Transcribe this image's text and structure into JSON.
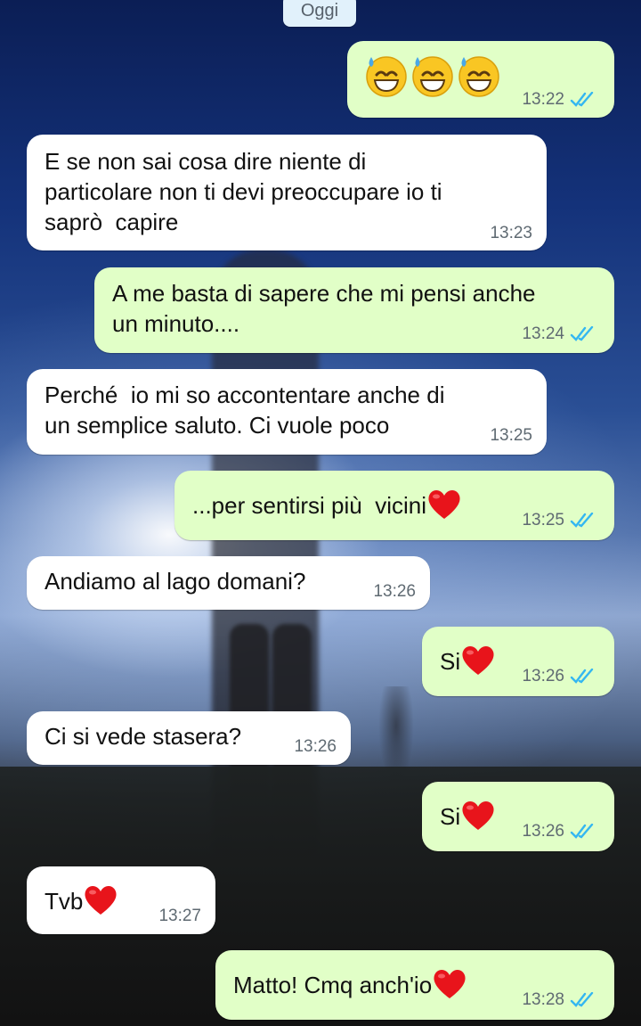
{
  "date_chip": "Oggi",
  "colors": {
    "incoming": "#ffffff",
    "outgoing": "#e1ffc7",
    "tick": "#34b7f1",
    "heart": "#e8141b"
  },
  "messages": [
    {
      "dir": "out",
      "kind": "emoji",
      "emoji": [
        "sweat-smile-emoji",
        "sweat-smile-emoji",
        "sweat-smile-emoji"
      ],
      "time": "13:22",
      "read": true
    },
    {
      "dir": "in",
      "text": "E se non sai cosa dire niente di\nparticolare non ti devi preoccupare io ti\nsaprò  capire",
      "time": "13:23"
    },
    {
      "dir": "out",
      "text": "A me basta di sapere che mi pensi anche\nun minuto....",
      "time": "13:24",
      "read": true
    },
    {
      "dir": "in",
      "text": "Perché  io mi so accontentare anche di\nun semplice saluto. Ci vuole poco",
      "time": "13:25"
    },
    {
      "dir": "out",
      "text": "...per sentirsi più  vicini",
      "heart": true,
      "time": "13:25",
      "read": true
    },
    {
      "dir": "in",
      "text": "Andiamo al lago domani?",
      "time": "13:26"
    },
    {
      "dir": "out",
      "text": "Si",
      "heart": true,
      "time": "13:26",
      "read": true
    },
    {
      "dir": "in",
      "text": "Ci si vede stasera?",
      "time": "13:26"
    },
    {
      "dir": "out",
      "text": "Si",
      "heart": true,
      "time": "13:26",
      "read": true
    },
    {
      "dir": "in",
      "text": "Tvb",
      "heart": true,
      "time": "13:27"
    },
    {
      "dir": "out",
      "text": "Matto! Cmq anch'io",
      "heart": true,
      "time": "13:28",
      "read": true
    }
  ]
}
